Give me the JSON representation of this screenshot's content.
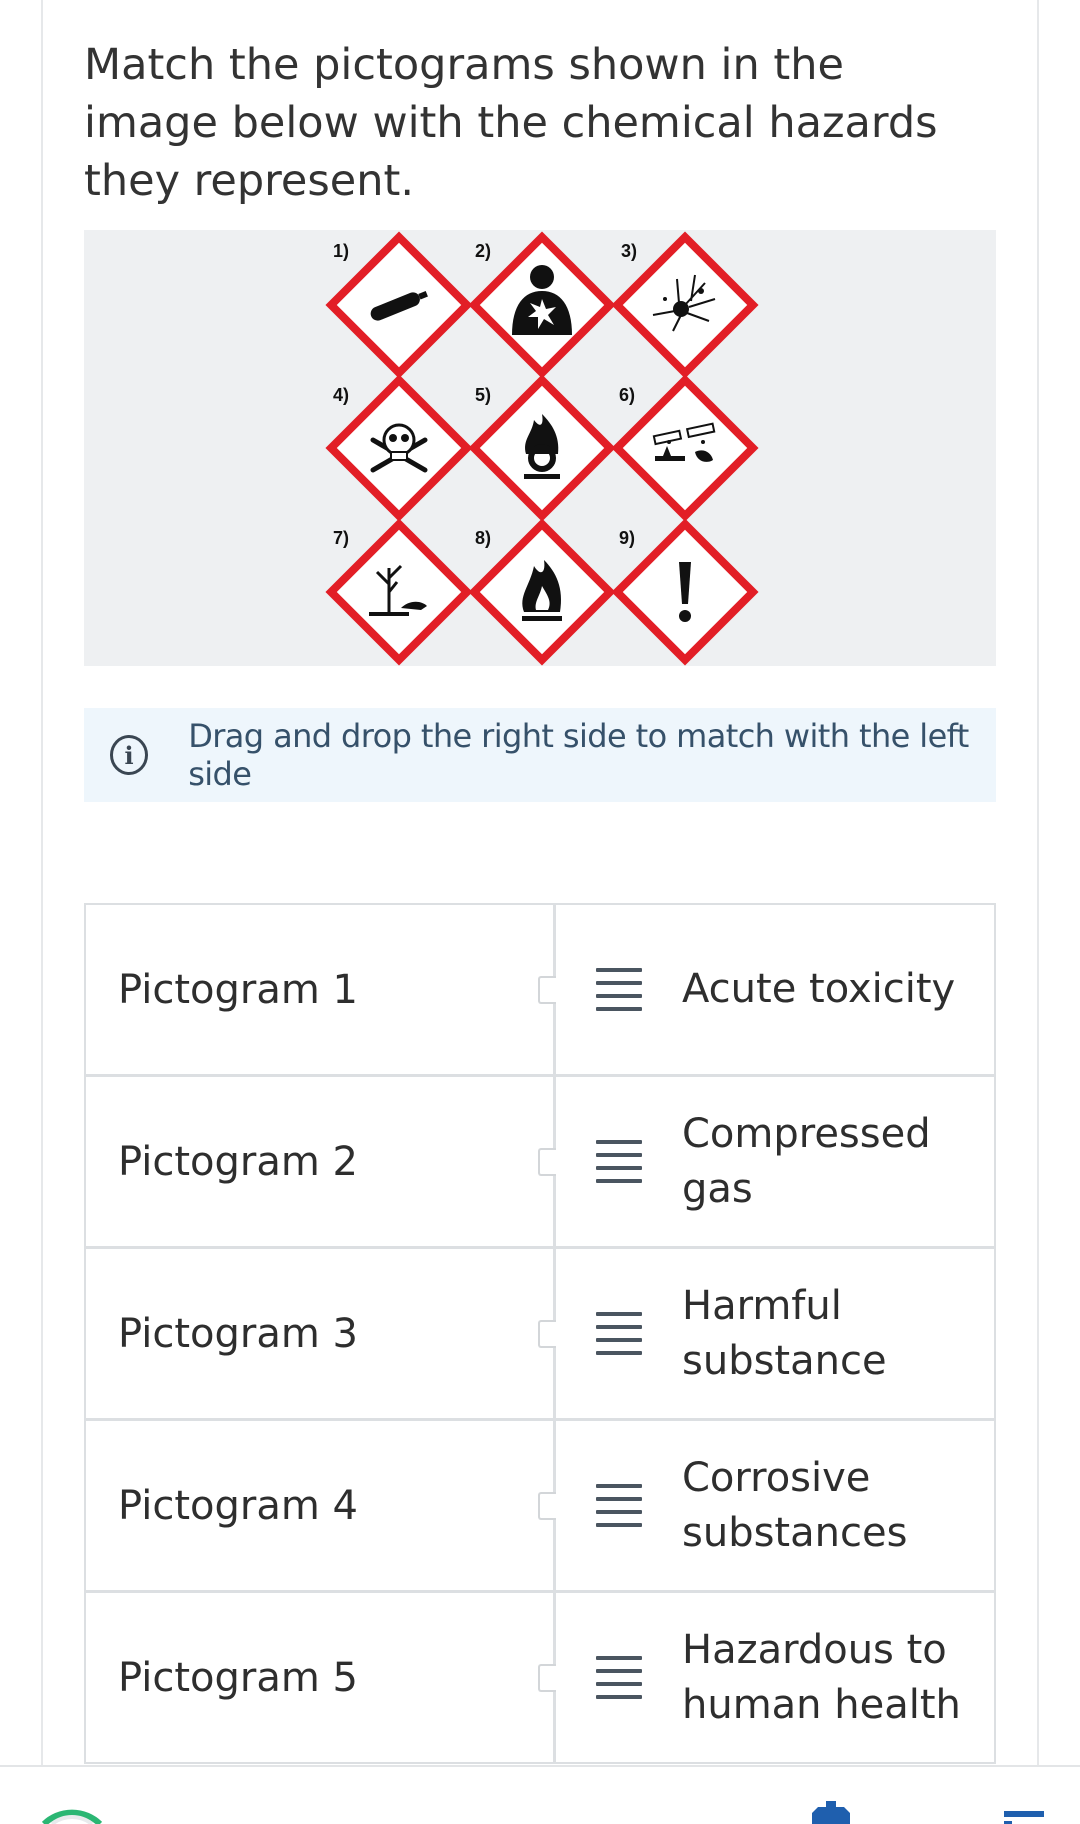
{
  "question": {
    "text": "Match the pictograms shown in the image below with the chemical hazards they represent."
  },
  "figure": {
    "labels": [
      "1)",
      "2)",
      "3)",
      "4)",
      "5)",
      "6)",
      "7)",
      "8)",
      "9)"
    ],
    "pictograms": [
      "gas-cylinder-icon",
      "health-hazard-icon",
      "exploding-bomb-icon",
      "skull-crossbones-icon",
      "flame-over-circle-icon",
      "corrosion-icon",
      "environment-icon",
      "flame-icon",
      "exclamation-mark-icon"
    ],
    "border_color": "#e21e26"
  },
  "hint": {
    "text": "Drag and drop the right side to match with the left side"
  },
  "rows": [
    {
      "left": "Pictogram 1",
      "right": "Acute toxicity"
    },
    {
      "left": "Pictogram 2",
      "right": "Compressed gas"
    },
    {
      "left": "Pictogram 3",
      "right": "Harmful substance"
    },
    {
      "left": "Pictogram 4",
      "right": "Corrosive substances"
    },
    {
      "left": "Pictogram 5",
      "right": "Hazardous to human health"
    }
  ],
  "colors": {
    "hint_background": "#eef6fc",
    "figure_background": "#eef0f2",
    "footer_accent": "#2bb673",
    "footer_icon": "#1f5fae"
  }
}
